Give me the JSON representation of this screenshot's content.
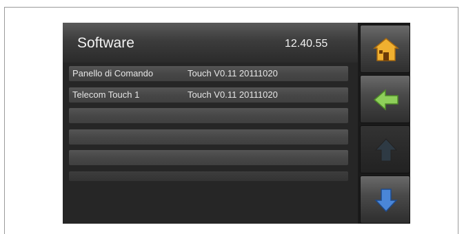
{
  "header": {
    "title": "Software",
    "time": "12.40.55"
  },
  "software_list": {
    "rows": [
      {
        "name": "Panello di Comando",
        "version": "Touch V0.11 20111020"
      },
      {
        "name": "Telecom Touch 1",
        "version": "Touch V0.11 20111020"
      },
      {
        "name": "",
        "version": ""
      },
      {
        "name": "",
        "version": ""
      },
      {
        "name": "",
        "version": ""
      },
      {
        "name": "",
        "version": ""
      }
    ]
  },
  "sidebar": {
    "buttons": [
      {
        "icon": "home-icon",
        "enabled": true,
        "color": "#f0b030"
      },
      {
        "icon": "arrow-left-icon",
        "enabled": true,
        "color": "#8ecf5a"
      },
      {
        "icon": "arrow-up-icon",
        "enabled": false,
        "color": "#2e3a44"
      },
      {
        "icon": "arrow-down-icon",
        "enabled": true,
        "color": "#4a86d8"
      }
    ]
  }
}
